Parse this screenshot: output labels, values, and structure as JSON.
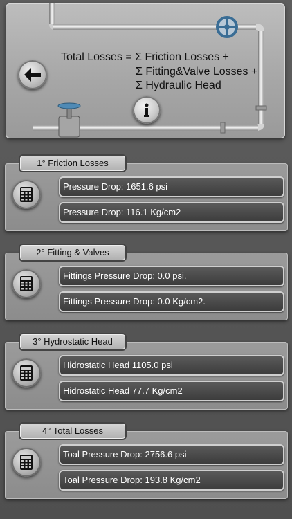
{
  "header": {
    "formula_line1": "Total  Losses = Σ Friction Losses  +",
    "formula_line2": "Σ Fitting&Valve Losses  +",
    "formula_line3": "Σ Hydraulic Head",
    "back_icon": "back-arrow-icon",
    "info_icon": "info-icon"
  },
  "sections": [
    {
      "title": "1° Friction Losses",
      "field1": "Pressure Drop: 1651.6 psi",
      "field2": "Pressure Drop: 116.1 Kg/cm2"
    },
    {
      "title": "2° Fitting & Valves",
      "field1": "Fittings Pressure Drop: 0.0 psi.",
      "field2": "Fittings Pressure Drop: 0.0 Kg/cm2."
    },
    {
      "title": "3° Hydrostatic Head",
      "field1": " Hidrostatic Head 1105.0  psi",
      "field2": " Hidrostatic Head 77.7  Kg/cm2"
    },
    {
      "title": "4° Total Losses",
      "field1": "Toal Pressure Drop: 2756.6 psi",
      "field2": "Toal Pressure Drop: 193.8 Kg/cm2"
    }
  ],
  "icons": {
    "calculator": "calculator-icon"
  }
}
